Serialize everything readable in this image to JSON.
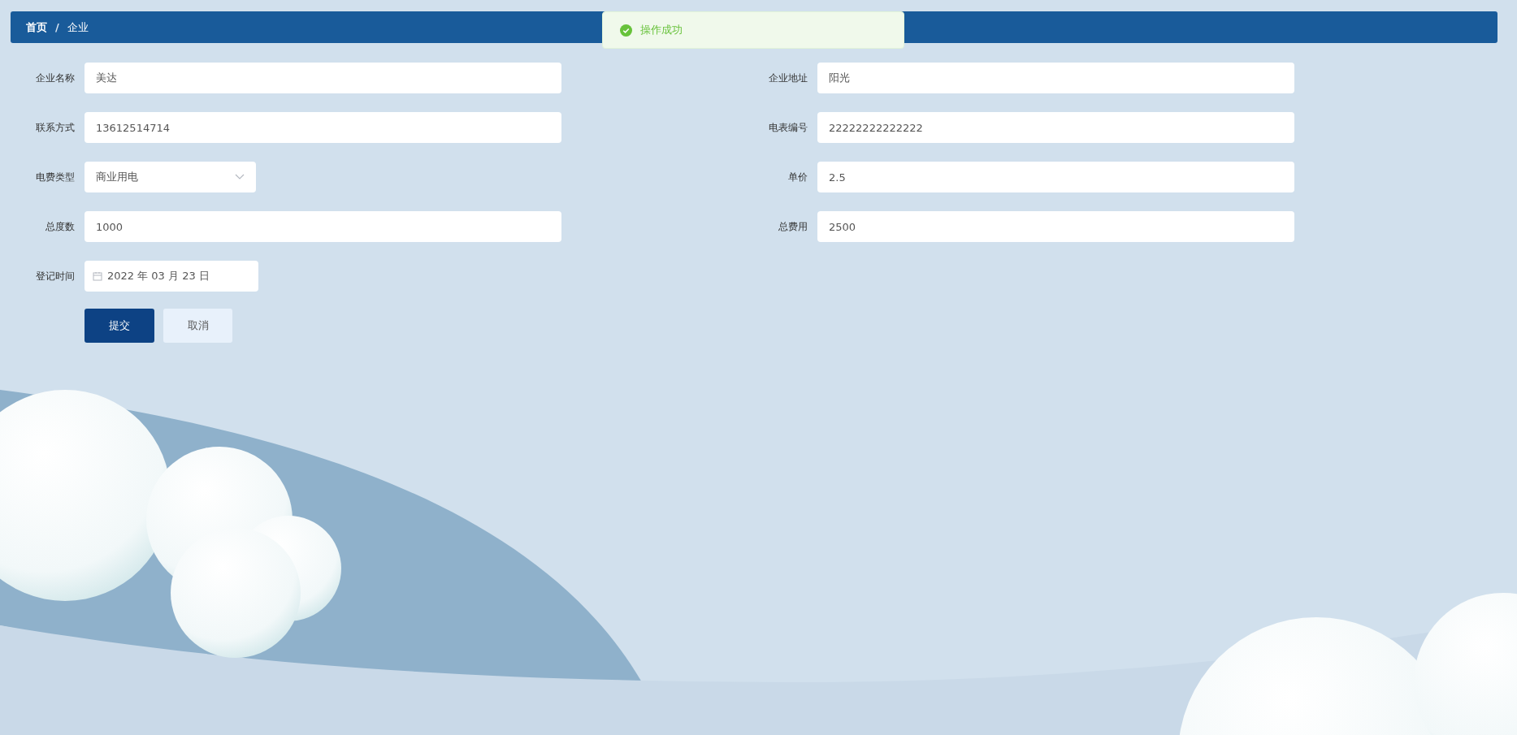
{
  "breadcrumb": [
    {
      "label": "首页"
    },
    {
      "label": "企业"
    }
  ],
  "breadcrumb_separator": "/",
  "toast": {
    "kind": "success",
    "message": "操作成功"
  },
  "fields": [
    {
      "label": "企业名称",
      "kind": "text",
      "value": "美达"
    },
    {
      "label": "企业地址",
      "kind": "text",
      "value": "阳光"
    },
    {
      "label": "联系方式",
      "kind": "text",
      "value": "13612514714"
    },
    {
      "label": "电表编号",
      "kind": "text",
      "value": "22222222222222"
    },
    {
      "label": "电费类型",
      "kind": "select",
      "value": "商业用电"
    },
    {
      "label": "单价",
      "kind": "text",
      "value": "2.5"
    },
    {
      "label": "总度数",
      "kind": "text",
      "value": "1000"
    },
    {
      "label": "总费用",
      "kind": "text",
      "value": "2500"
    },
    {
      "label": "登记时间",
      "kind": "date",
      "value": "2022 年 03 月 23 日"
    }
  ],
  "buttons": [
    {
      "label": "提交",
      "kind": "primary"
    },
    {
      "label": "取消",
      "kind": "default"
    }
  ]
}
